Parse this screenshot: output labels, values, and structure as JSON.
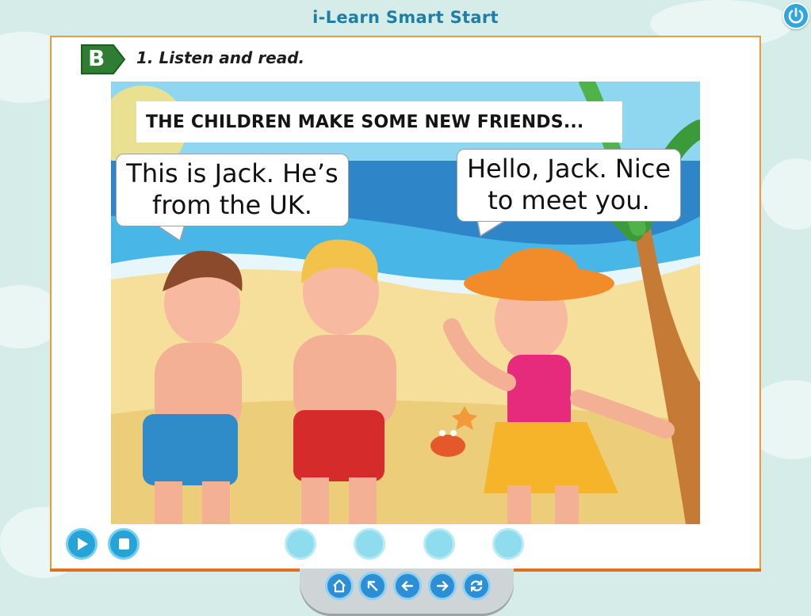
{
  "app": {
    "title": "i-Learn Smart Start"
  },
  "exercise": {
    "section_badge": "B",
    "instruction": "1. Listen and read."
  },
  "story": {
    "caption": "THE CHILDREN MAKE SOME NEW FRIENDS...",
    "bubbles": [
      {
        "line1": "This is Jack. He’s",
        "line2": "from the UK."
      },
      {
        "line1": "Hello, Jack. Nice",
        "line2": "to meet you."
      }
    ]
  },
  "audio_controls": {
    "play_icon": "play-icon",
    "stop_icon": "stop-icon"
  },
  "pagination": {
    "dot_count": 4
  },
  "bottom_nav": {
    "icons": [
      "home-icon",
      "up-icon",
      "back-icon",
      "next-icon",
      "refresh-icon"
    ]
  },
  "colors": {
    "title_blue": "#1e7fa6",
    "panel_border": "#f19a3a",
    "badge_green": "#2e7d32",
    "button_blue": "#27a3d8",
    "dot_cyan": "#8fdcef"
  }
}
